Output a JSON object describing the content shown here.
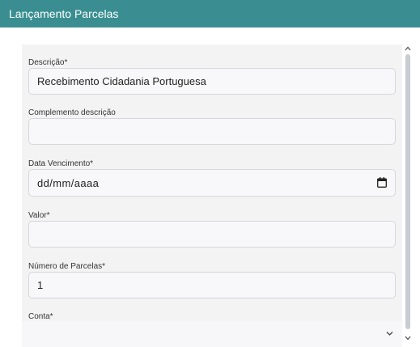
{
  "header": {
    "title": "Lançamento Parcelas"
  },
  "form": {
    "descricao": {
      "label": "Descrição*",
      "value": "Recebimento Cidadania Portuguesa"
    },
    "complemento": {
      "label": "Complemento descrição",
      "value": ""
    },
    "data_vencimento": {
      "label": "Data Vencimento*",
      "placeholder": "dd/mm/aaaa"
    },
    "valor": {
      "label": "Valor*",
      "value": ""
    },
    "numero_parcelas": {
      "label": "Número de Parcelas*",
      "value": "1"
    },
    "conta": {
      "label": "Conta*",
      "value": ""
    }
  },
  "icons": {
    "calendar": "calendar-icon",
    "select_arrow": "chevron-down-icon",
    "scroll_up": "scroll-up-arrow",
    "scroll_down": "scroll-down-arrow"
  },
  "colors": {
    "header_bg": "#3a8e91",
    "panel_bg": "#f3f3f4",
    "input_border": "#d7d7db"
  }
}
